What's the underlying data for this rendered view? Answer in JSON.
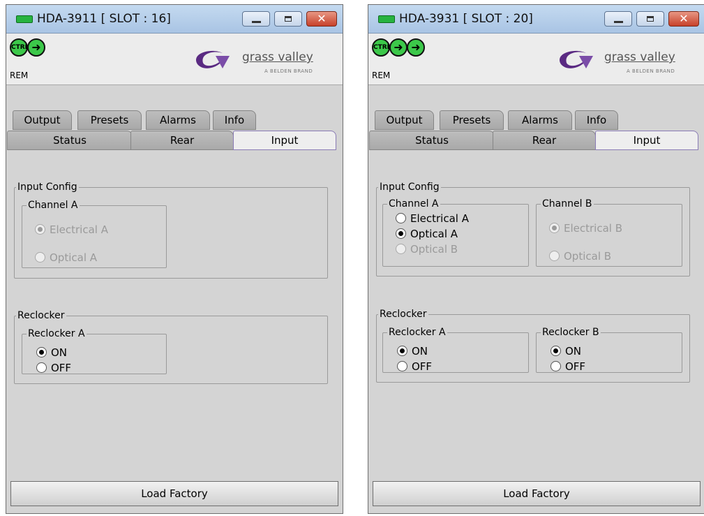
{
  "windows": [
    {
      "title": "HDA-3911 [ SLOT : 16]",
      "status_badge": "CTRL",
      "rem_label": "REM",
      "brand": {
        "name": "grass valley",
        "sub": "A BELDEN BRAND"
      },
      "tabs_back": [
        "Output",
        "Presets",
        "Alarms",
        "Info"
      ],
      "tabs_front": [
        "Status",
        "Rear",
        "Input"
      ],
      "active_tab": "Input",
      "input_config": {
        "label": "Input Config",
        "channel_a": {
          "label": "Channel A",
          "options": [
            {
              "label": "Electrical A",
              "selected": true,
              "enabled": false
            },
            {
              "label": "Optical A",
              "selected": false,
              "enabled": false
            }
          ]
        }
      },
      "reclocker": {
        "label": "Reclocker",
        "reclocker_a": {
          "label": "Reclocker A",
          "options": [
            {
              "label": "ON",
              "selected": true
            },
            {
              "label": "OFF",
              "selected": false
            }
          ]
        }
      },
      "load_factory": "Load Factory"
    },
    {
      "title": "HDA-3931 [ SLOT : 20]",
      "status_badge": "CTRL",
      "rem_label": "REM",
      "brand": {
        "name": "grass valley",
        "sub": "A BELDEN BRAND"
      },
      "tabs_back": [
        "Output",
        "Presets",
        "Alarms",
        "Info"
      ],
      "tabs_front": [
        "Status",
        "Rear",
        "Input"
      ],
      "active_tab": "Input",
      "input_config": {
        "label": "Input Config",
        "channel_a": {
          "label": "Channel A",
          "options": [
            {
              "label": "Electrical A",
              "selected": false,
              "enabled": true
            },
            {
              "label": "Optical A",
              "selected": true,
              "enabled": true
            },
            {
              "label": "Optical B",
              "selected": false,
              "enabled": false
            }
          ]
        },
        "channel_b": {
          "label": "Channel B",
          "options": [
            {
              "label": "Electrical B",
              "selected": true,
              "enabled": false
            },
            {
              "label": "Optical B",
              "selected": false,
              "enabled": false
            }
          ]
        }
      },
      "reclocker": {
        "label": "Reclocker",
        "reclocker_a": {
          "label": "Reclocker A",
          "options": [
            {
              "label": "ON",
              "selected": true
            },
            {
              "label": "OFF",
              "selected": false
            }
          ]
        },
        "reclocker_b": {
          "label": "Reclocker B",
          "options": [
            {
              "label": "ON",
              "selected": true
            },
            {
              "label": "OFF",
              "selected": false
            }
          ]
        }
      },
      "load_factory": "Load Factory"
    }
  ],
  "colors": {
    "titlebar": "#b7cfea",
    "led": "#27b340",
    "icon_green": "#3cc84a",
    "panel": "#d4d4d4",
    "close_button": "#c7412a"
  },
  "icons": [
    "status-led-icon",
    "ctrl-status-icon",
    "arrow-right-icon",
    "grass-valley-logo"
  ]
}
